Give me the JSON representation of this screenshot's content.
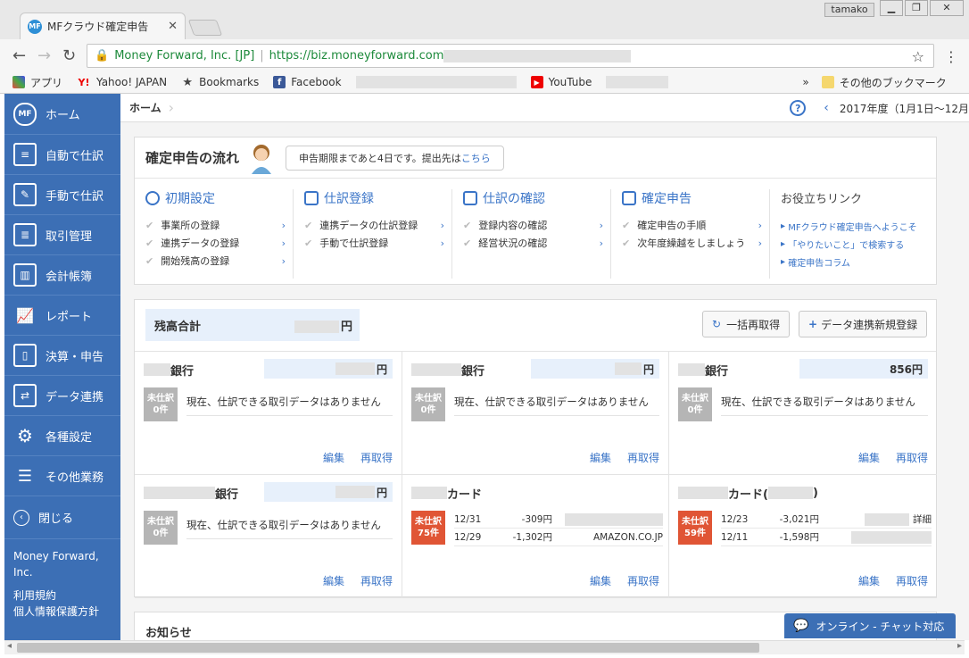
{
  "browser": {
    "tab_title": "MFクラウド確定申告",
    "tab_favicon": "MF",
    "user": "tamako",
    "url_origin": "Money Forward, Inc. [JP]",
    "url": "https://biz.moneyforward.com",
    "bookmarks": [
      {
        "label": "アプリ",
        "icon": "apps-icon"
      },
      {
        "label": "Yahoo! JAPAN",
        "icon": "yahoo-icon"
      },
      {
        "label": "Bookmarks",
        "icon": "star-icon"
      },
      {
        "label": "Facebook",
        "icon": "facebook-icon"
      },
      {
        "label": "YouTube",
        "icon": "youtube-icon"
      }
    ],
    "other_bookmarks": "その他のブックマーク"
  },
  "sidebar": {
    "items": [
      {
        "label": "ホーム",
        "icon": "mf-cloud-icon"
      },
      {
        "label": "自動で仕訳",
        "icon": "auto-journal-icon"
      },
      {
        "label": "手動で仕訳",
        "icon": "manual-journal-icon"
      },
      {
        "label": "取引管理",
        "icon": "transaction-icon"
      },
      {
        "label": "会計帳簿",
        "icon": "book-icon"
      },
      {
        "label": "レポート",
        "icon": "report-icon"
      },
      {
        "label": "決算・申告",
        "icon": "settlement-icon"
      },
      {
        "label": "データ連携",
        "icon": "data-link-icon"
      },
      {
        "label": "各種設定",
        "icon": "gear-icon"
      },
      {
        "label": "その他業務",
        "icon": "list-icon"
      }
    ],
    "close": "閉じる",
    "company": "Money Forward, Inc.",
    "terms": "利用規約",
    "privacy": "個人情報保護方針"
  },
  "header": {
    "breadcrumb": "ホーム",
    "period": "2017年度（1月1日〜12月"
  },
  "flow": {
    "title": "確定申告の流れ",
    "notice": "申告期限まであと4日です。提出先は",
    "notice_link": "こちら",
    "columns": [
      {
        "title": "初期設定",
        "items": [
          "事業所の登録",
          "連携データの登録",
          "開始残高の登録"
        ]
      },
      {
        "title": "仕訳登録",
        "items": [
          "連携データの仕訳登録",
          "手動で仕訳登録"
        ]
      },
      {
        "title": "仕訳の確認",
        "items": [
          "登録内容の確認",
          "経営状況の確認"
        ]
      },
      {
        "title": "確定申告",
        "items": [
          "確定申告の手順",
          "次年度繰越をしましょう"
        ]
      }
    ],
    "help_title": "お役立ちリンク",
    "help_links": [
      "MFクラウド確定申告へようこそ",
      "「やりたいこと」で検索する",
      "確定申告コラム"
    ]
  },
  "accounts": {
    "total_label": "残高合計",
    "total_suffix": "円",
    "refresh_all": "一括再取得",
    "add_link": "データ連携新規登録",
    "edit": "編集",
    "refetch": "再取得",
    "no_data": "現在、仕訳できる取引データはありません",
    "cards": [
      {
        "name": "銀行",
        "balance": "円",
        "badge": [
          "未仕訳",
          "0件"
        ],
        "badge_color": "gray"
      },
      {
        "name": "銀行",
        "balance": "円",
        "badge": [
          "未仕訳",
          "0件"
        ],
        "badge_color": "gray"
      },
      {
        "name": "銀行",
        "balance": "856円",
        "badge": [
          "未仕訳",
          "0件"
        ],
        "badge_color": "gray"
      },
      {
        "name": "銀行",
        "balance": "円",
        "badge": [
          "未仕訳",
          "0件"
        ],
        "badge_color": "gray"
      },
      {
        "name": "カード",
        "balance": "",
        "badge": [
          "未仕訳",
          "75件"
        ],
        "badge_color": "red",
        "transactions": [
          {
            "date": "12/31",
            "amount": "-309円",
            "name": ""
          },
          {
            "date": "12/29",
            "amount": "-1,302円",
            "name": "AMAZON.CO.JP"
          }
        ]
      },
      {
        "name": "カード(",
        "name_end": ")",
        "balance": "",
        "badge": [
          "未仕訳",
          "59件"
        ],
        "badge_color": "red",
        "transactions": [
          {
            "date": "12/23",
            "amount": "-3,021円",
            "name": "詳細"
          },
          {
            "date": "12/11",
            "amount": "-1,598円",
            "name": ""
          }
        ]
      }
    ]
  },
  "news_title": "お知らせ",
  "chat_label": "オンライン - チャット対応"
}
